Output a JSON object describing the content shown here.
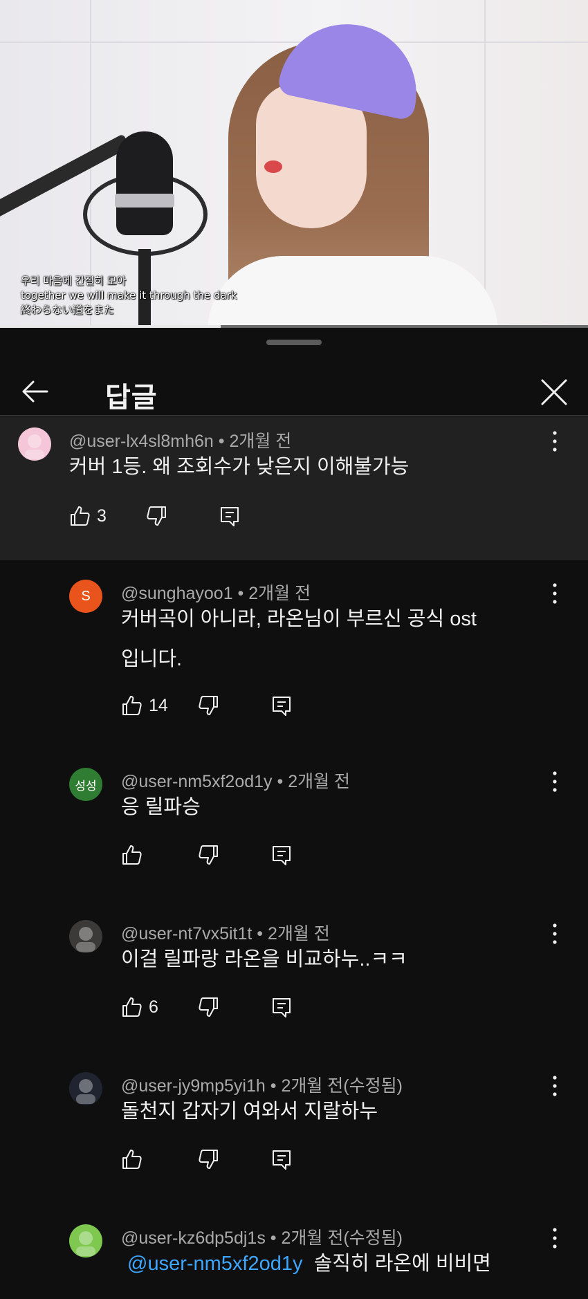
{
  "video": {
    "subtitles": [
      "우리 마음에 간절히 모아",
      "together we will make it through the dark",
      "終わらない道をまた"
    ],
    "progress": 0.375
  },
  "header": {
    "title": "답글"
  },
  "comments": [
    {
      "author": "@user-lx4sl8mh6n",
      "time": "2개월 전",
      "text": [
        "커버 1등. 왜 조회수가 낮은지 이해불가능"
      ],
      "likes": "3",
      "avatar_color": "#f5c6d8",
      "avatar_text": ""
    },
    {
      "author": "@sunghayoo1",
      "time": "2개월 전",
      "text": [
        "커버곡이 아니라, 라온님이 부르신 공식 ost",
        "입니다."
      ],
      "likes": "14",
      "avatar_color": "#e9541c",
      "avatar_text": "S"
    },
    {
      "author": "@user-nm5xf2od1y",
      "time": "2개월 전",
      "text": [
        "응 릴파승"
      ],
      "likes": "",
      "avatar_color": "#2f7d32",
      "avatar_text": "성성"
    },
    {
      "author": "@user-nt7vx5it1t",
      "time": "2개월 전",
      "text": [
        "이걸 릴파랑 라온을 비교하누..ㅋㅋ"
      ],
      "likes": "6",
      "avatar_color": "#3c3a38",
      "avatar_text": ""
    },
    {
      "author": "@user-jy9mp5yi1h",
      "time": "2개월 전(수정됨)",
      "text": [
        "돌천지 갑자기 여와서 지랄하누"
      ],
      "likes": "",
      "avatar_color": "#1f2430",
      "avatar_text": ""
    },
    {
      "author": "@user-kz6dp5dj1s",
      "time": "2개월 전(수정됨)",
      "mention": "@user-nm5xf2od1y",
      "text": [
        "솔직히 라온에 비비면"
      ],
      "likes": "",
      "avatar_color": "#7ec850",
      "avatar_text": ""
    }
  ]
}
